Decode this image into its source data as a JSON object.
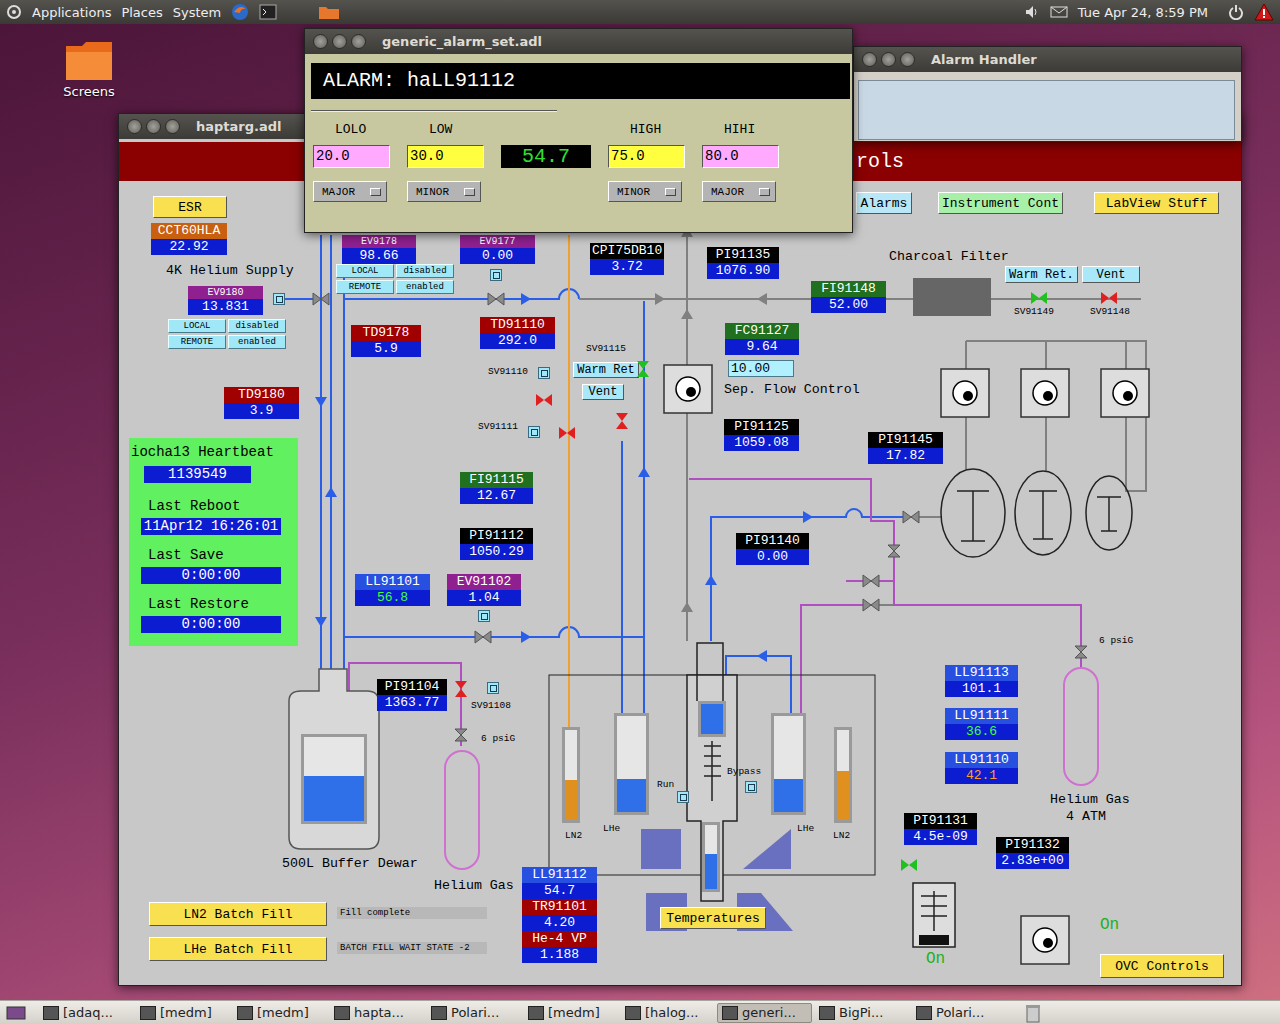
{
  "top_panel": {
    "menus": [
      "Applications",
      "Places",
      "System"
    ],
    "clock": "Tue Apr 24, 8:59 PM"
  },
  "desktop": {
    "icons": [
      {
        "label": "Screens"
      }
    ]
  },
  "alarm_handler": {
    "title": "Alarm Handler"
  },
  "haptarg": {
    "title": "haptarg.adl",
    "banner": "rols",
    "buttons": [
      {
        "label": "ESR",
        "color": "#f8e050"
      },
      {
        "label": "Alarms",
        "color": "#b8e8f8"
      },
      {
        "label": "Instrument Cont",
        "color": "#a8f0a8"
      },
      {
        "label": "LabView Stuff",
        "color": "#f8e050"
      },
      {
        "label": "Warm Ret.",
        "color": "#a8e8f8"
      },
      {
        "label": "Vent",
        "color": "#a8e8f8"
      },
      {
        "label": "Warm Ret",
        "color": "#a8e8f8"
      },
      {
        "label": "Vent",
        "color": "#a8e8f8"
      },
      {
        "label": "Temperatures",
        "color": "#f8e050"
      },
      {
        "label": "OVC Controls",
        "color": "#f8e050"
      }
    ],
    "readouts": [
      {
        "label": "CCT60HLA",
        "value": "22.92",
        "kind": "standard",
        "label_color": "#c86010",
        "value_color": "#ffffff"
      },
      {
        "label": "EV9180",
        "value": "13.831",
        "kind": "valve",
        "label_color": "#902090",
        "value_color": "#ffffff"
      },
      {
        "label": "EV9178",
        "value": "98.66",
        "kind": "valve",
        "label_color": "#902090",
        "value_color": "#ffffff"
      },
      {
        "label": "EV9177",
        "value": "0.00",
        "kind": "valve",
        "label_color": "#902090",
        "value_color": "#ffffff"
      },
      {
        "label": "TD9178",
        "value": "5.9",
        "kind": "standard",
        "label_color": "#a00000",
        "value_color": "#ffffff"
      },
      {
        "label": "TD9180",
        "value": "3.9",
        "kind": "standard",
        "label_color": "#a00000",
        "value_color": "#ffffff"
      },
      {
        "label": "TD91110",
        "value": "292.0",
        "kind": "standard",
        "label_color": "#a00000",
        "value_color": "#ffffff"
      },
      {
        "label": "CPI75DB10",
        "value": "3.72",
        "kind": "standard",
        "label_color": "#000000",
        "value_color": "#ffffff"
      },
      {
        "label": "PI91135",
        "value": "1076.90",
        "kind": "standard",
        "label_color": "#000000",
        "value_color": "#ffffff"
      },
      {
        "label": "FI91148",
        "value": "52.00",
        "kind": "standard",
        "label_color": "#207020",
        "value_color": "#ffffff"
      },
      {
        "label": "FC91127",
        "value": "9.64",
        "kind": "standard",
        "label_color": "#207020",
        "value_color": "#ffffff"
      },
      {
        "label": "PI91125",
        "value": "1059.08",
        "kind": "standard",
        "label_color": "#000000",
        "value_color": "#ffffff"
      },
      {
        "label": "PI91145",
        "value": "17.82",
        "kind": "standard",
        "label_color": "#000000",
        "value_color": "#ffffff"
      },
      {
        "label": "FI91115",
        "value": "12.67",
        "kind": "standard",
        "label_color": "#207020",
        "value_color": "#ffffff"
      },
      {
        "label": "PI91112",
        "value": "1050.29",
        "kind": "standard",
        "label_color": "#000000",
        "value_color": "#ffffff"
      },
      {
        "label": "PI91140",
        "value": "0.00",
        "kind": "standard",
        "label_color": "#000000",
        "value_color": "#ffffff"
      },
      {
        "label": "LL91101",
        "value": "56.8",
        "kind": "standard",
        "label_color": "#2850e0",
        "value_color": "#40ff40"
      },
      {
        "label": "EV91102",
        "value": "1.04",
        "kind": "standard",
        "label_color": "#902090",
        "value_color": "#ffffff"
      },
      {
        "label": "PI91104",
        "value": "1363.77",
        "kind": "standard",
        "label_color": "#000000",
        "value_color": "#ffffff"
      },
      {
        "label": "LL91113",
        "value": "101.1",
        "kind": "standard",
        "label_color": "#2850e0",
        "value_color": "#ffffff"
      },
      {
        "label": "LL91111",
        "value": "36.6",
        "kind": "standard",
        "label_color": "#2850e0",
        "value_color": "#40ff40"
      },
      {
        "label": "LL91110",
        "value": "42.1",
        "kind": "standard",
        "label_color": "#2850e0",
        "value_color": "#ff9a30"
      },
      {
        "label": "PI91131",
        "value": "4.5e-09",
        "kind": "standard",
        "label_color": "#000000",
        "value_color": "#ffffff"
      },
      {
        "label": "PI91132",
        "value": "2.83e+00",
        "kind": "standard",
        "label_color": "#000000",
        "value_color": "#ffffff"
      },
      {
        "label": "LL91112",
        "value": "54.7",
        "kind": "standard",
        "label_color": "#2850e0",
        "value_color": "#ffffff"
      },
      {
        "label": "TR91101",
        "value": "4.20",
        "kind": "standard",
        "label_color": "#a00000",
        "value_color": "#ffffff"
      },
      {
        "label": "He-4 VP",
        "value": "1.188",
        "kind": "standard",
        "label_color": "#a00000",
        "value_color": "#ffffff"
      }
    ],
    "local_remote": [
      {
        "local": "LOCAL",
        "local_state": "disabled",
        "remote": "REMOTE",
        "remote_state": "enabled"
      },
      {
        "local": "LOCAL",
        "local_state": "disabled",
        "remote": "REMOTE",
        "remote_state": "enabled"
      }
    ],
    "setpoint": "10.00",
    "labels": [
      {
        "text": "4K Helium Supply",
        "kind": "large"
      },
      {
        "text": "Charcoal Filter",
        "kind": "large"
      },
      {
        "text": "Sep. Flow Control",
        "kind": "large"
      },
      {
        "text": "Helium Gas",
        "kind": "large"
      },
      {
        "text": "Helium Gas",
        "kind": "large"
      },
      {
        "text": "4 ATM",
        "kind": "large"
      },
      {
        "text": "6 psiG",
        "kind": "small"
      },
      {
        "text": "6 psiG",
        "kind": "small"
      },
      {
        "text": "SV91115",
        "kind": "small"
      },
      {
        "text": "SV91110",
        "kind": "small"
      },
      {
        "text": "SV91111",
        "kind": "small"
      },
      {
        "text": "SV91149",
        "kind": "small"
      },
      {
        "text": "SV91148",
        "kind": "small"
      },
      {
        "text": "SV91108",
        "kind": "small"
      },
      {
        "text": "Run",
        "kind": "small"
      },
      {
        "text": "Bypass",
        "kind": "small"
      },
      {
        "text": "On",
        "kind": "status"
      },
      {
        "text": "On",
        "kind": "status"
      }
    ],
    "valves": [
      {
        "open": true
      },
      {
        "open": false
      },
      {
        "open": true
      },
      {
        "open": false
      },
      {
        "open": false
      },
      {
        "open": false
      },
      {
        "open": false
      },
      {
        "open": true
      }
    ],
    "tanks": [
      {
        "label": "500L Buffer Dewar",
        "level": 0.53,
        "color": "#2f6fe8"
      },
      {
        "label": "LN2",
        "level": 0.45,
        "color": "#e0901e"
      },
      {
        "label": "LHe",
        "level": 0.34,
        "color": "#2f6fe8"
      },
      {
        "level": 1.0,
        "color": "#2f6fe8"
      },
      {
        "level": 0.55,
        "color": "#2f6fe8"
      },
      {
        "label": "LHe",
        "level": 0.34,
        "color": "#2f6fe8"
      },
      {
        "label": "LN2",
        "level": 0.55,
        "color": "#e0901e"
      }
    ],
    "heartbeat": {
      "title": "iocha13 Heartbeat",
      "count": "1139549",
      "fields": [
        {
          "label": "Last Reboot",
          "value": "11Apr12 16:26:01"
        },
        {
          "label": "Last Save",
          "value": "0:00:00"
        },
        {
          "label": "Last Restore",
          "value": "0:00:00"
        }
      ]
    },
    "batch_fills": [
      {
        "button": "LN2 Batch Fill",
        "status": "Fill complete"
      },
      {
        "button": "LHe Batch Fill",
        "status": "BATCH FILL WAIT STATE -2"
      }
    ]
  },
  "alarm_set": {
    "title": "generic_alarm_set.adl",
    "alarm": "ALARM: haLL91112",
    "current": "54.7",
    "limits": [
      {
        "label": "LOLO",
        "value": "20.0",
        "severity": "MAJOR",
        "color": "#ffaaff"
      },
      {
        "label": "LOW",
        "value": "30.0",
        "severity": "MINOR",
        "color": "#ffff40"
      },
      {
        "label": "HIGH",
        "value": "75.0",
        "severity": "MINOR",
        "color": "#ffff40"
      },
      {
        "label": "HIHI",
        "value": "80.0",
        "severity": "MAJOR",
        "color": "#ffaaff"
      }
    ]
  },
  "taskbar": [
    {
      "label": "[adaq...",
      "selected": false
    },
    {
      "label": "[medm]",
      "selected": false
    },
    {
      "label": "[medm]",
      "selected": false
    },
    {
      "label": "hapta...",
      "selected": false
    },
    {
      "label": "Polari...",
      "selected": false
    },
    {
      "label": "[medm]",
      "selected": false
    },
    {
      "label": "[halog...",
      "selected": false
    },
    {
      "label": "generi...",
      "selected": true
    },
    {
      "label": "BigPi...",
      "selected": false
    },
    {
      "label": "Polari...",
      "selected": false
    }
  ]
}
